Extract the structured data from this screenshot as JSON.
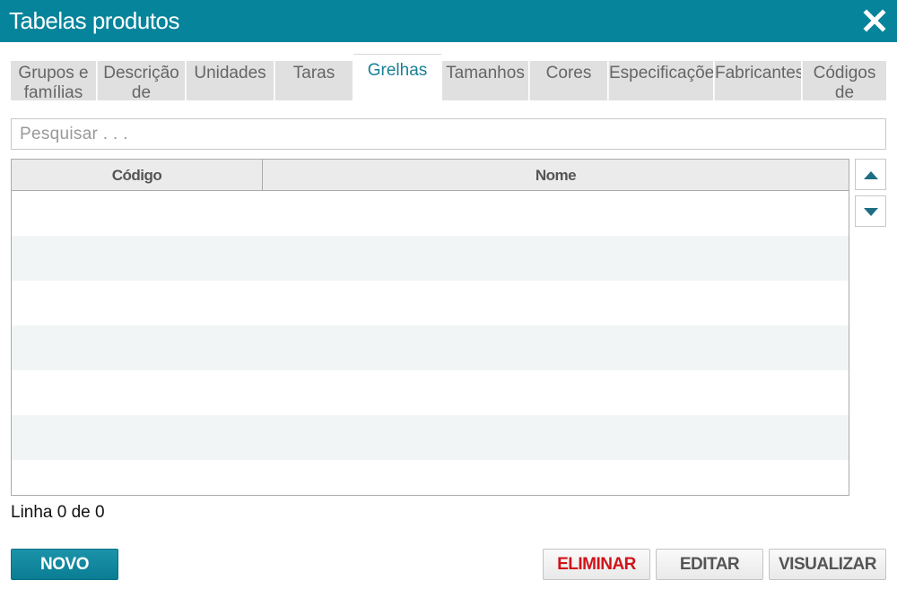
{
  "window": {
    "title": "Tabelas produtos",
    "close_icon": "close-icon"
  },
  "tabs": [
    {
      "label": "Grupos e famílias",
      "active": false
    },
    {
      "label": "Descrição de",
      "active": false
    },
    {
      "label": "Unidades",
      "active": false
    },
    {
      "label": "Taras",
      "active": false
    },
    {
      "label": "Grelhas",
      "active": true
    },
    {
      "label": "Tamanhos",
      "active": false
    },
    {
      "label": "Cores",
      "active": false
    },
    {
      "label": "Especificações",
      "active": false
    },
    {
      "label": "Fabricantes",
      "active": false
    },
    {
      "label": "Códigos de",
      "active": false
    }
  ],
  "search": {
    "placeholder": "Pesquisar . . .",
    "value": ""
  },
  "grid": {
    "columns": [
      "Código",
      "Nome"
    ],
    "rows": []
  },
  "scroll": {
    "up_icon": "triangle-up-icon",
    "down_icon": "triangle-down-icon"
  },
  "status": {
    "text": "Linha 0 de 0"
  },
  "buttons": {
    "novo": "NOVO",
    "eliminar": "ELIMINAR",
    "editar": "EDITAR",
    "visualizar": "VISUALIZAR"
  },
  "colors": {
    "accent": "#06849b",
    "active_tab_text": "#1a7f96",
    "danger": "#d0141a"
  }
}
